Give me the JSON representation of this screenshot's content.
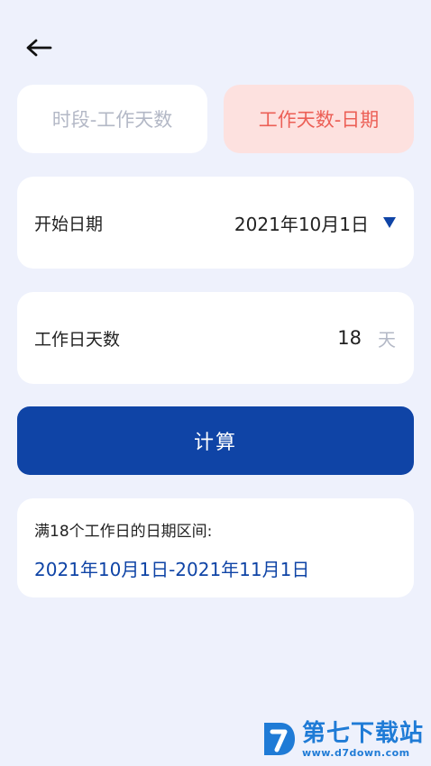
{
  "tabs": [
    {
      "label": "时段-工作天数",
      "active": false
    },
    {
      "label": "工作天数-日期",
      "active": true
    }
  ],
  "start_date": {
    "label": "开始日期",
    "value": "2021年10月1日"
  },
  "work_days": {
    "label": "工作日天数",
    "value": "18",
    "unit": "天"
  },
  "calculate_button": {
    "label": "计算"
  },
  "result": {
    "label": "满18个工作日的日期区间:",
    "value": "2021年10月1日-2021年11月1日"
  },
  "watermark": {
    "title": "第七下载站",
    "url": "www.d7down.com"
  },
  "colors": {
    "background": "#eef1fc",
    "primary": "#0f44a6",
    "active_tab_bg": "#fde1df",
    "active_tab_text": "#ec5f56",
    "muted_text": "#b3b8c6"
  },
  "icons": {
    "back": "arrow-left-icon",
    "dropdown": "caret-down-icon"
  }
}
